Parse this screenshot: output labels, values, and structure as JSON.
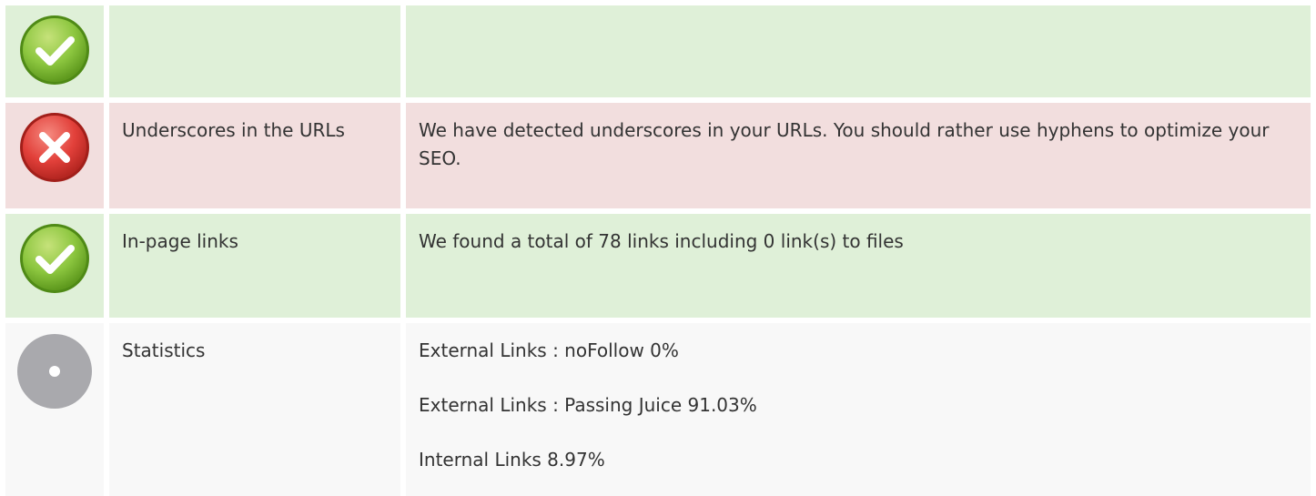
{
  "rows": [
    {
      "status": "ok",
      "icon": "check-icon",
      "label": "",
      "value": ""
    },
    {
      "status": "error",
      "icon": "cross-icon",
      "label": "Underscores in the URLs",
      "value": "We have detected underscores in your URLs. You should rather use hyphens to optimize your SEO."
    },
    {
      "status": "ok",
      "icon": "check-icon",
      "label": "In-page links",
      "value": "We found a total of 78 links including 0 link(s) to files"
    },
    {
      "status": "info",
      "icon": "info-dot-icon",
      "label": "Statistics",
      "values": [
        "External Links : noFollow 0%",
        "External Links : Passing Juice 91.03%",
        "Internal Links 8.97%"
      ]
    }
  ],
  "colors": {
    "ok_bg": "#dff0d8",
    "error_bg": "#f2dede",
    "info_bg": "#f8f8f8",
    "check_green": "#8cc63f",
    "cross_red": "#e2403a",
    "info_gray": "#a9a9ad"
  }
}
